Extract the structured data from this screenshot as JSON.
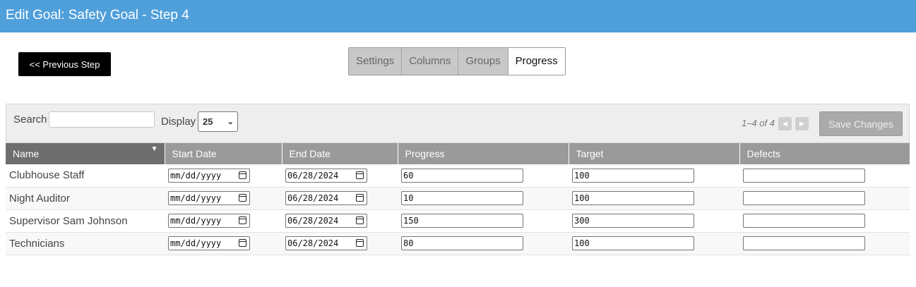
{
  "header": {
    "title": "Edit Goal: Safety Goal - Step 4"
  },
  "nav": {
    "previous_label": "<< Previous Step"
  },
  "tabs": [
    {
      "label": "Settings",
      "active": false
    },
    {
      "label": "Columns",
      "active": false
    },
    {
      "label": "Groups",
      "active": false
    },
    {
      "label": "Progress",
      "active": true
    }
  ],
  "toolbar": {
    "search_label": "Search",
    "search_value": "",
    "display_label": "Display",
    "display_value": "25",
    "pager_text": "1–4 of 4",
    "save_label": "Save Changes"
  },
  "table": {
    "columns": [
      "Name",
      "Start Date",
      "End Date",
      "Progress",
      "Target",
      "Defects"
    ],
    "sorted_column": "Name",
    "rows": [
      {
        "name": "Clubhouse Staff",
        "start_date": "mm/dd/yyyy",
        "end_date": "06/28/2024",
        "progress": "60",
        "target": "100",
        "defects": ""
      },
      {
        "name": "Night Auditor",
        "start_date": "mm/dd/yyyy",
        "end_date": "06/28/2024",
        "progress": "10",
        "target": "100",
        "defects": ""
      },
      {
        "name": "Supervisor Sam Johnson",
        "start_date": "mm/dd/yyyy",
        "end_date": "06/28/2024",
        "progress": "150",
        "target": "300",
        "defects": ""
      },
      {
        "name": "Technicians",
        "start_date": "mm/dd/yyyy",
        "end_date": "06/28/2024",
        "progress": "80",
        "target": "100",
        "defects": ""
      }
    ]
  },
  "colors": {
    "header_bg": "#4f9fdb",
    "table_header_bg": "#9a9a9a",
    "sorted_header_bg": "#6e6e6e"
  },
  "icons": {
    "sort": "sort-down-icon",
    "prev_page": "prev-page-icon",
    "next_page": "next-page-icon",
    "calendar": "calendar-icon",
    "select": "chevron-down-icon"
  }
}
